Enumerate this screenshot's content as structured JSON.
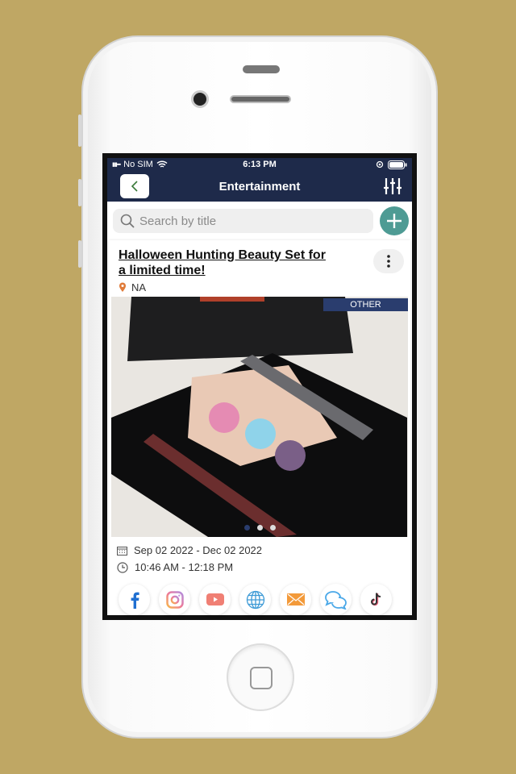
{
  "status_bar": {
    "carrier": "No SIM",
    "time": "6:13 PM"
  },
  "nav": {
    "title": "Entertainment",
    "back_icon": "chevron-left-icon",
    "filter_icon": "sliders-icon"
  },
  "search": {
    "placeholder": "Search by title",
    "value": ""
  },
  "colors": {
    "nav": "#1e2a4a",
    "accent": "#4e9b94",
    "badge": "#2a3d6e",
    "background": "#bfa764"
  },
  "card": {
    "title": "Halloween Hunting Beauty Set for a limited time!",
    "location": "NA",
    "category_badge": "OTHER",
    "image_count": 3,
    "active_image": 1,
    "date_range": "Sep 02 2022 - Dec 02 2022",
    "time_range": "10:46 AM - 12:18 PM",
    "social": [
      "facebook",
      "instagram",
      "youtube",
      "website",
      "email",
      "chat",
      "tiktok"
    ]
  }
}
